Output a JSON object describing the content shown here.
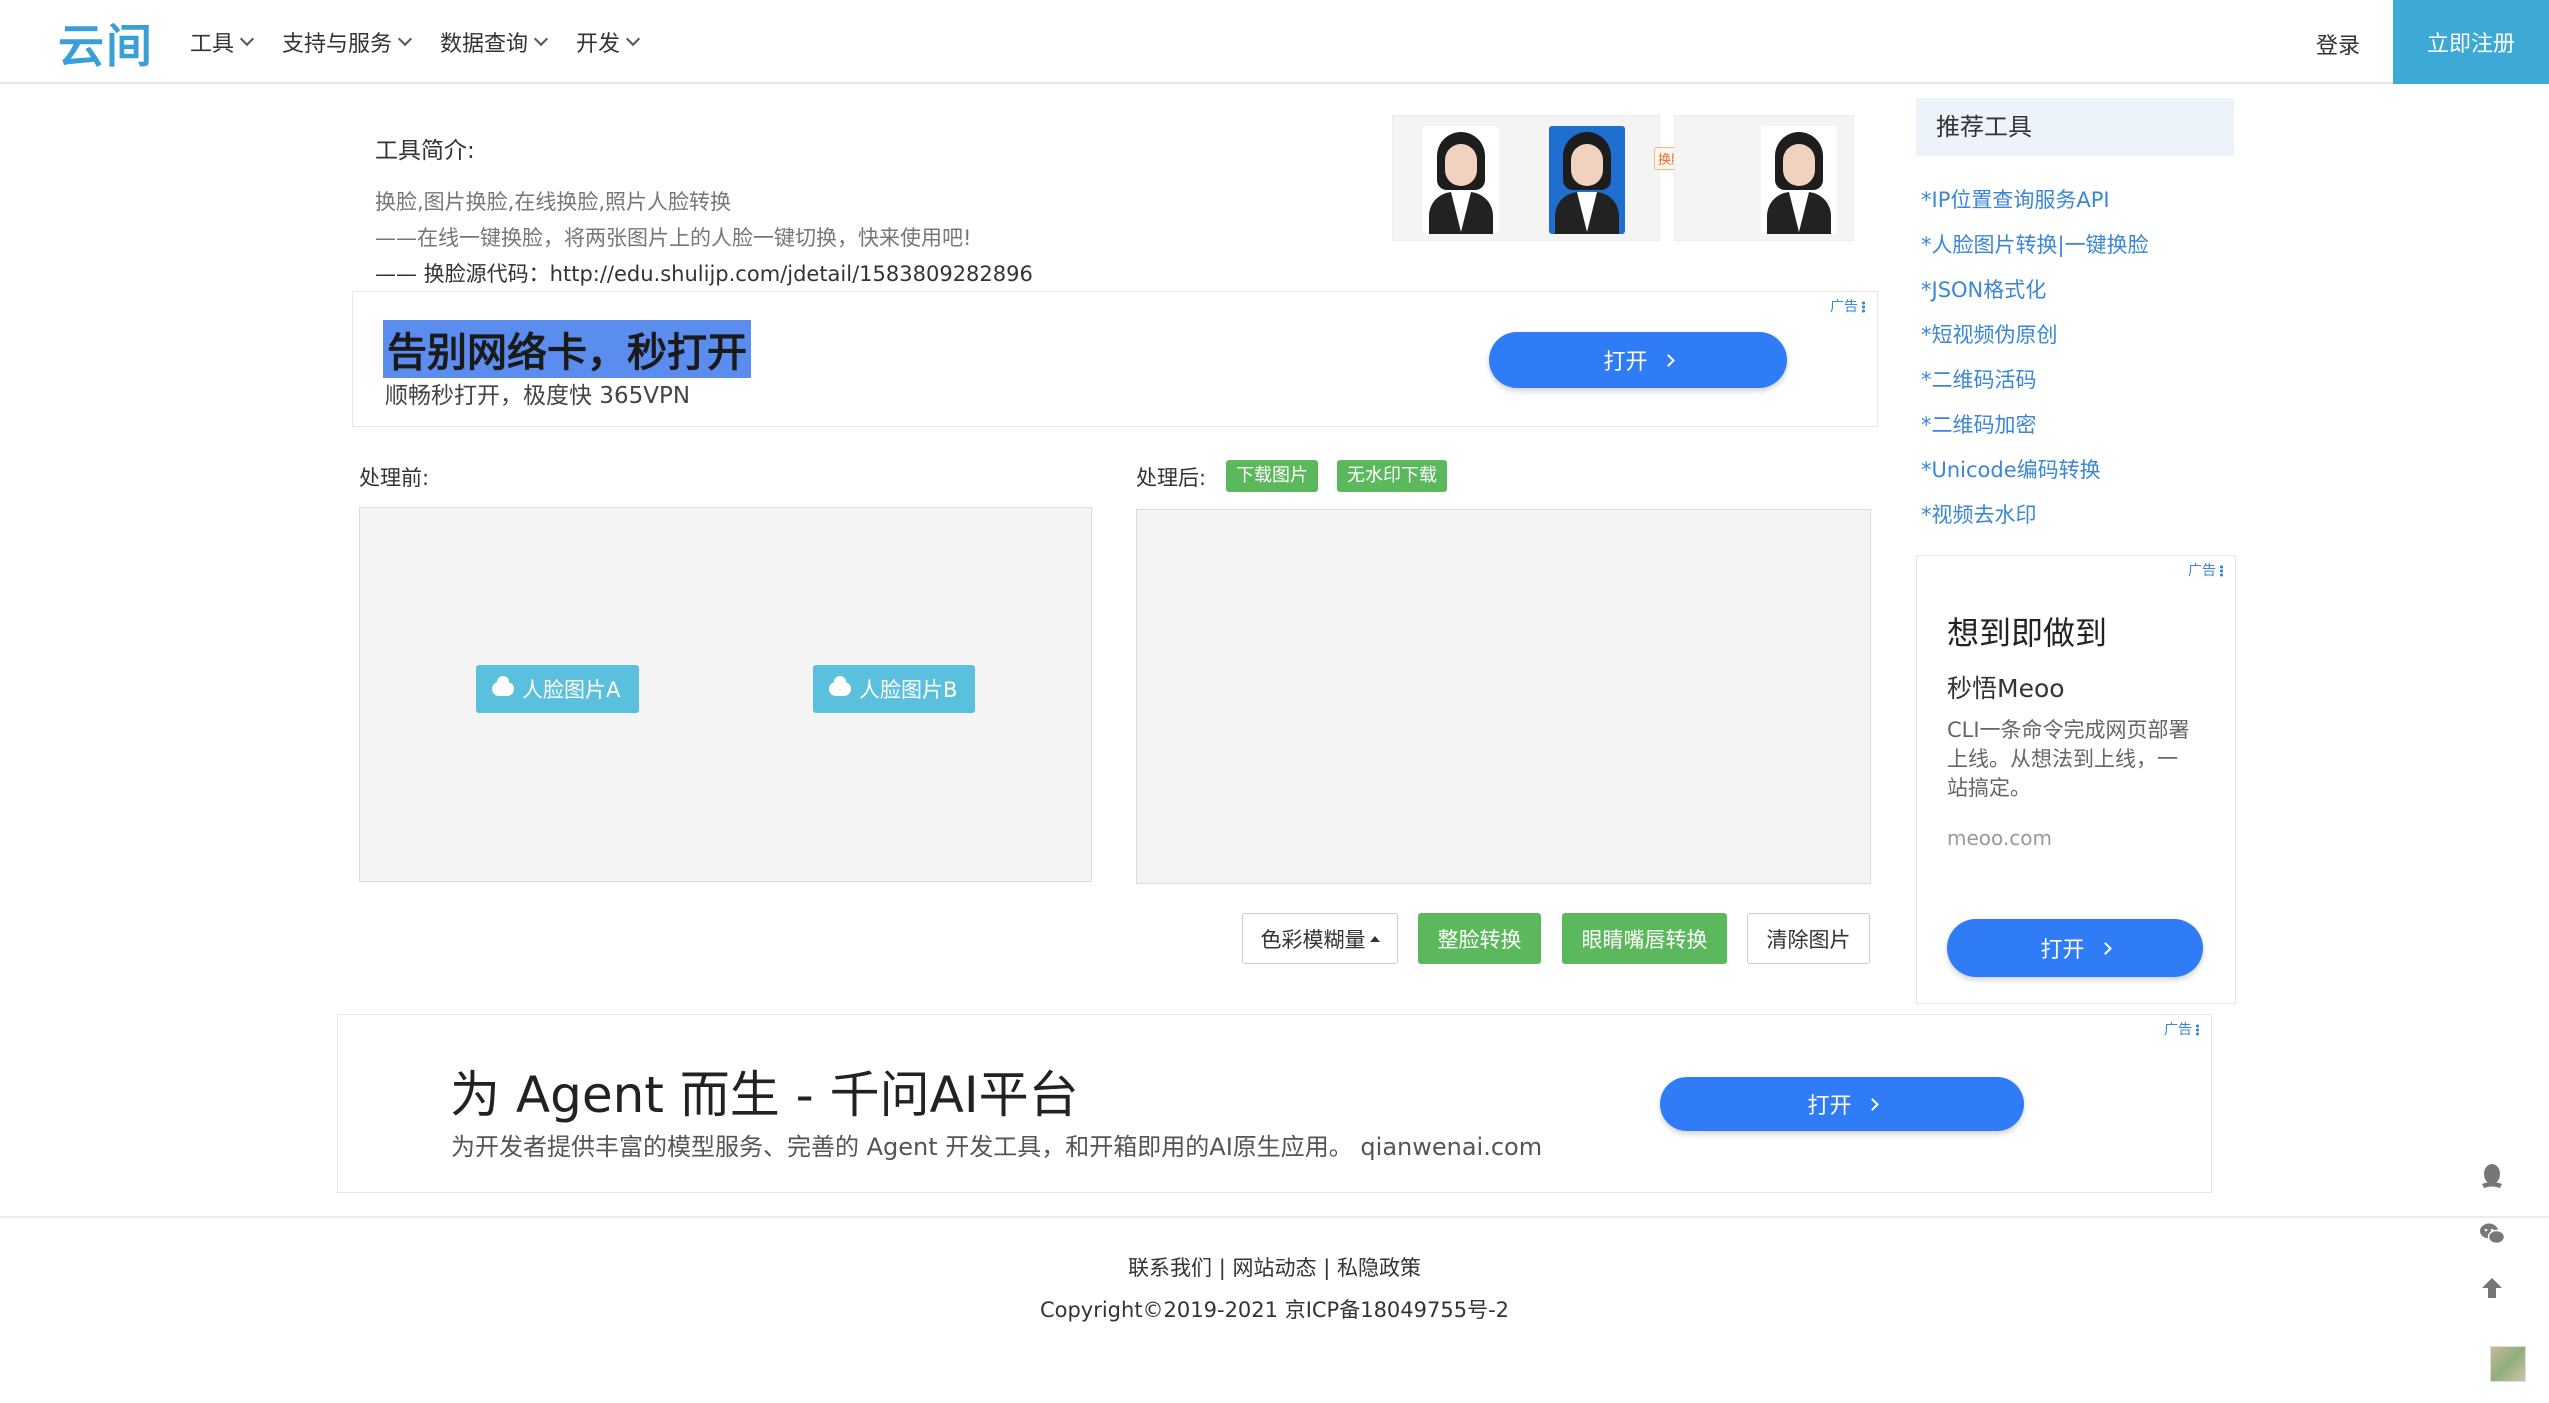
{
  "header": {
    "logo": "云间",
    "nav": [
      "工具",
      "支持与服务",
      "数据查询",
      "开发"
    ],
    "login": "登录",
    "register": "立即注册"
  },
  "intro": {
    "title": "工具简介:",
    "line1": "换脸,图片换脸,在线换脸,照片人脸转换",
    "line2": "——在线一键换脸，将两张图片上的人脸一键切换，快来使用吧!",
    "line3": "—— 换脸源代码：http://edu.shulijp.com/jdetail/1583809282896",
    "swap_label": "换脸效果"
  },
  "ad_top": {
    "mark": "广告",
    "title": "告别网络卡，秒打开",
    "subtitle": "顺畅秒打开，极度快 365VPN",
    "button": "打开"
  },
  "process": {
    "before_label": "处理前:",
    "after_label": "处理后:",
    "download_btn": "下载图片",
    "no_watermark_btn": "无水印下载",
    "upload_a": "人脸图片A",
    "upload_b": "人脸图片B",
    "blur_btn": "色彩模糊量",
    "whole_face_btn": "整脸转换",
    "eyes_btn": "眼睛嘴唇转换",
    "clear_btn": "清除图片"
  },
  "sidebar": {
    "heading": "推荐工具",
    "links": [
      "*IP位置查询服务API",
      "*人脸图片转换|一键换脸",
      "*JSON格式化",
      "*短视频伪原创",
      "*二维码活码",
      "*二维码加密",
      "*Unicode编码转换",
      "*视频去水印"
    ]
  },
  "ad_side": {
    "mark": "广告",
    "title": "想到即做到",
    "brand": "秒悟Meoo",
    "desc": "CLI一条命令完成网页部署上线。从想法到上线，一站搞定。",
    "url": "meoo.com",
    "button": "打开"
  },
  "ad_bottom": {
    "mark": "广告",
    "title": "为 Agent 而生 - 千问AI平台",
    "subtitle": "为开发者提供丰富的模型服务、完善的 Agent 开发工具，和开箱即用的AI原生应用。 qianwenai.com",
    "button": "打开"
  },
  "footer": {
    "contact": "联系我们",
    "news": "网站动态",
    "privacy": "私隐政策",
    "sep": "|",
    "copyright": "Copyright©2019-2021 京ICP备18049755号-2"
  },
  "icons": {
    "qq": "qq-icon",
    "wechat": "wechat-icon",
    "top": "arrow-up-icon"
  },
  "colors": {
    "brand": "#3da9d6",
    "green": "#5cb85c",
    "link": "#3a86d8",
    "ad_button": "#2f7cf6"
  }
}
